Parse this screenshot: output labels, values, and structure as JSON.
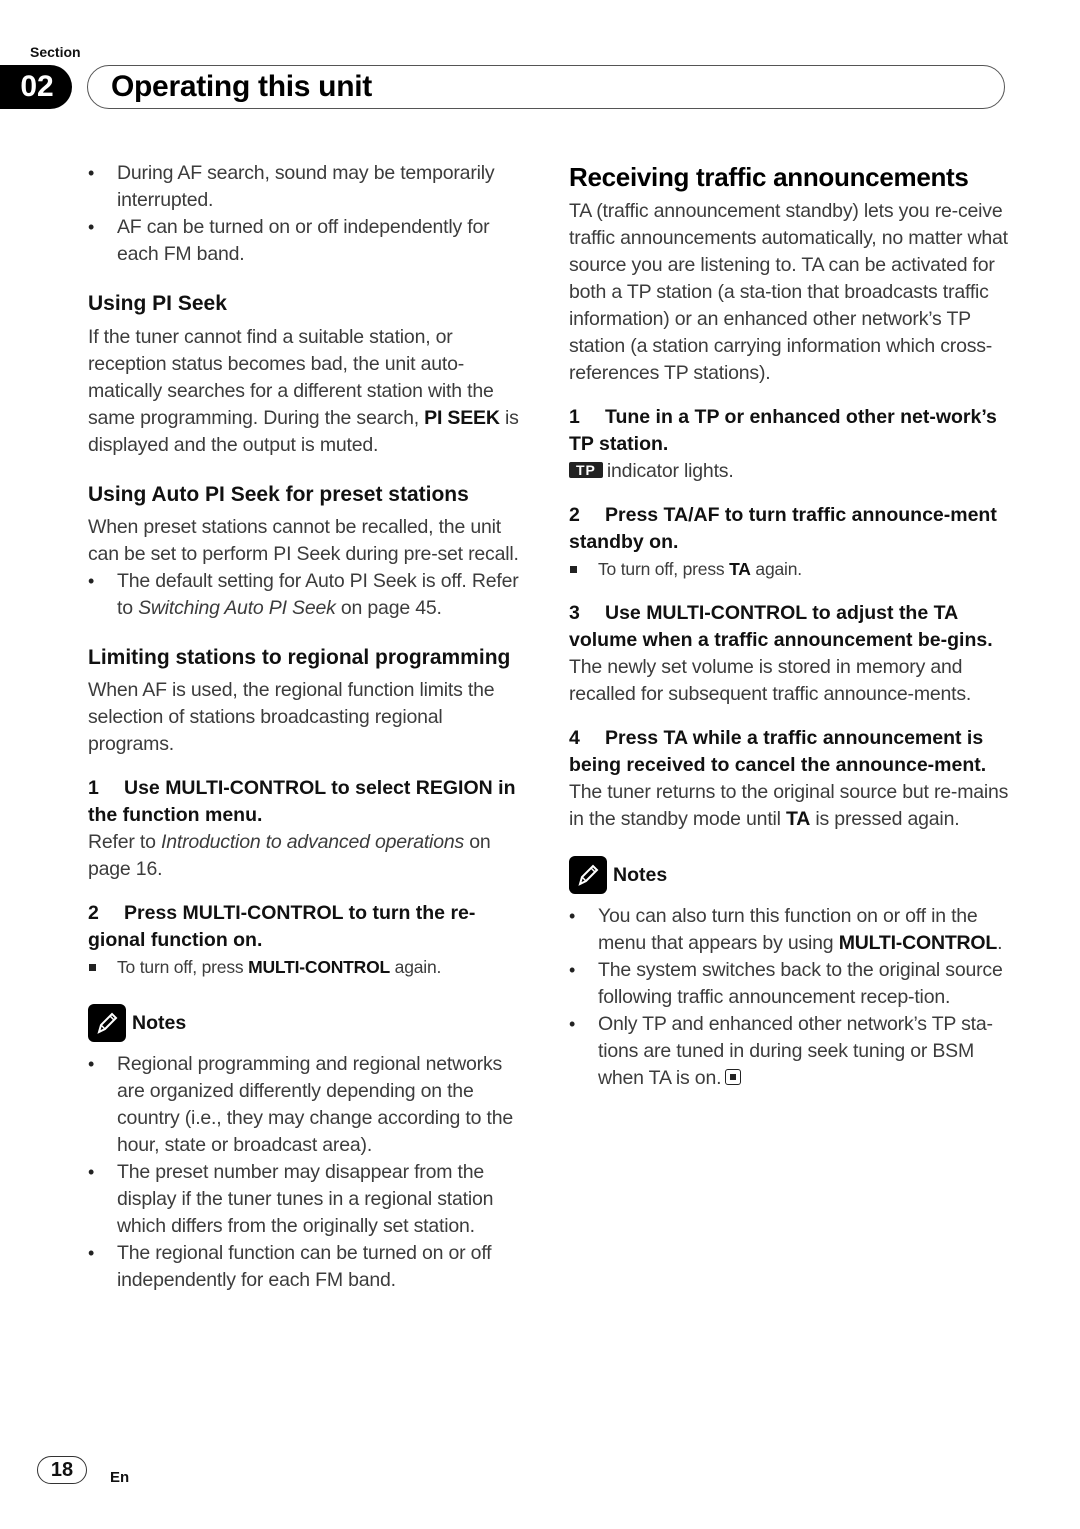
{
  "header": {
    "section_label": "Section",
    "section_number": "02",
    "title": "Operating this unit"
  },
  "left": {
    "intro_bullets": [
      "During AF search, sound may be temporarily interrupted.",
      "AF can be turned on or off independently for each FM band."
    ],
    "pi_seek": {
      "heading": "Using PI Seek",
      "text_before": "If the tuner cannot find a suitable station, or reception status becomes bad, the unit auto-matically searches for a different station with the same programming. During the search,",
      "bold_term": "PI SEEK",
      "text_after": "is displayed and the output is muted."
    },
    "auto_pi_seek": {
      "heading": "Using Auto PI Seek for preset stations",
      "text": "When preset stations cannot be recalled, the unit can be set to perform PI Seek during pre-set recall.",
      "bullet_text": "The default setting for Auto PI Seek is off. Refer to",
      "bullet_link": "Switching Auto PI Seek",
      "bullet_tail": "on page 45."
    },
    "regional": {
      "heading": "Limiting stations to regional programming",
      "text": "When AF is used, the regional function limits the selection of stations broadcasting regional programs.",
      "step1_num": "1",
      "step1_text": "Use MULTI-CONTROL to select REGION in the function menu.",
      "step1_ref_prefix": "Refer to",
      "step1_ref_link": "Introduction to advanced operations",
      "step1_ref_tail": "on page 16.",
      "step2_num": "2",
      "step2_text": "Press MULTI-CONTROL to turn the re-gional function on.",
      "step2_note_prefix": "To turn off, press",
      "step2_note_bold": "MULTI-CONTROL",
      "step2_note_tail": "again."
    },
    "notes": {
      "label": "Notes",
      "items": [
        "Regional programming and regional networks are organized differently depending on the country (i.e., they may change according to the hour, state or broadcast area).",
        "The preset number may disappear from the display if the tuner tunes in a regional station which differs from the originally set station.",
        "The regional function can be turned on or off independently for each FM band."
      ]
    }
  },
  "right": {
    "heading": "Receiving traffic announcements",
    "intro": "TA (traffic announcement standby) lets you re-ceive traffic announcements automatically, no matter what source you are listening to. TA can be activated for both a TP station (a sta-tion that broadcasts traffic information) or an enhanced other network’s TP station (a station carrying information which cross-references TP stations).",
    "steps": [
      {
        "num": "1",
        "text": "Tune in a TP or enhanced other net-work’s TP station.",
        "badge": "TP",
        "detail": "indicator lights."
      },
      {
        "num": "2",
        "text": "Press TA/AF to turn traffic announce-ment standby on.",
        "note_prefix": "To turn off, press",
        "note_bold": "TA",
        "note_tail": "again."
      },
      {
        "num": "3",
        "text": "Use MULTI-CONTROL to adjust the TA volume when a traffic announcement be-gins.",
        "detail": "The newly set volume is stored in memory and recalled for subsequent traffic announce-ments."
      },
      {
        "num": "4",
        "text": "Press TA while a traffic announcement is being received to cancel the announce-ment.",
        "detail_prefix": "The tuner returns to the original source but re-mains in the standby mode until",
        "detail_bold": "TA",
        "detail_tail": "is pressed again."
      }
    ],
    "notes": {
      "label": "Notes",
      "item1_prefix": "You can also turn this function on or off in the menu that appears by using",
      "item1_bold": "MULTI-CONTROL",
      "item1_tail": ".",
      "item2": "The system switches back to the original source following traffic announcement recep-tion.",
      "item3": "Only TP and enhanced other network’s TP sta-tions are tuned in during seek tuning or BSM when TA is on."
    }
  },
  "footer": {
    "page_number": "18",
    "language": "En"
  }
}
